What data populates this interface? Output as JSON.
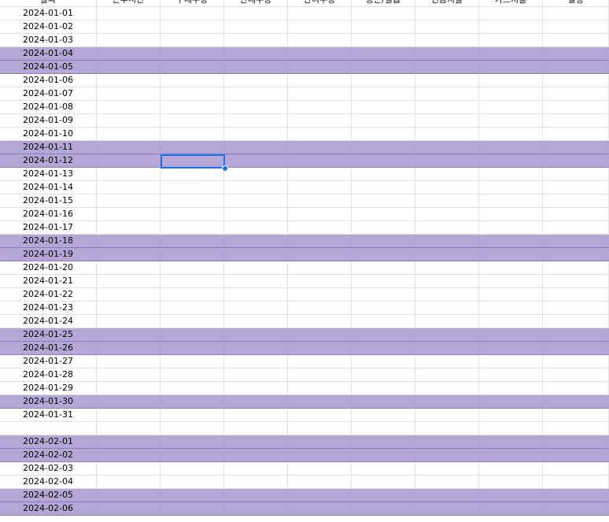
{
  "headers": [
    "날짜",
    "근무시간",
    "구매수량",
    "판매수량",
    "잔여수량",
    "용돈/월급",
    "현금지출",
    "카드지출",
    "일정"
  ],
  "rows": [
    {
      "date": "2024-01-01",
      "highlight": false
    },
    {
      "date": "2024-01-02",
      "highlight": false
    },
    {
      "date": "2024-01-03",
      "highlight": false
    },
    {
      "date": "2024-01-04",
      "highlight": true
    },
    {
      "date": "2024-01-05",
      "highlight": true
    },
    {
      "date": "2024-01-06",
      "highlight": false
    },
    {
      "date": "2024-01-07",
      "highlight": false
    },
    {
      "date": "2024-01-08",
      "highlight": false
    },
    {
      "date": "2024-01-09",
      "highlight": false
    },
    {
      "date": "2024-01-10",
      "highlight": false
    },
    {
      "date": "2024-01-11",
      "highlight": true
    },
    {
      "date": "2024-01-12",
      "highlight": true
    },
    {
      "date": "2024-01-13",
      "highlight": false
    },
    {
      "date": "2024-01-14",
      "highlight": false
    },
    {
      "date": "2024-01-15",
      "highlight": false
    },
    {
      "date": "2024-01-16",
      "highlight": false
    },
    {
      "date": "2024-01-17",
      "highlight": false
    },
    {
      "date": "2024-01-18",
      "highlight": true
    },
    {
      "date": "2024-01-19",
      "highlight": true
    },
    {
      "date": "2024-01-20",
      "highlight": false
    },
    {
      "date": "2024-01-21",
      "highlight": false
    },
    {
      "date": "2024-01-22",
      "highlight": false
    },
    {
      "date": "2024-01-23",
      "highlight": false
    },
    {
      "date": "2024-01-24",
      "highlight": false
    },
    {
      "date": "2024-01-25",
      "highlight": true
    },
    {
      "date": "2024-01-26",
      "highlight": true
    },
    {
      "date": "2024-01-27",
      "highlight": false
    },
    {
      "date": "2024-01-28",
      "highlight": false
    },
    {
      "date": "2024-01-29",
      "highlight": false
    },
    {
      "date": "2024-01-30",
      "highlight": true
    },
    {
      "date": "2024-01-31",
      "highlight": false
    },
    {
      "date": "",
      "highlight": false
    },
    {
      "date": "2024-02-01",
      "highlight": true
    },
    {
      "date": "2024-02-02",
      "highlight": true
    },
    {
      "date": "2024-02-03",
      "highlight": false
    },
    {
      "date": "2024-02-04",
      "highlight": false
    },
    {
      "date": "2024-02-05",
      "highlight": true
    },
    {
      "date": "2024-02-06",
      "highlight": true
    }
  ],
  "colors": {
    "highlight_fill": "#b4a7d6",
    "selection": "#1a73e8",
    "gridline": "#e1e1e1"
  },
  "selected_cell": {
    "row": 11,
    "col": 2
  }
}
